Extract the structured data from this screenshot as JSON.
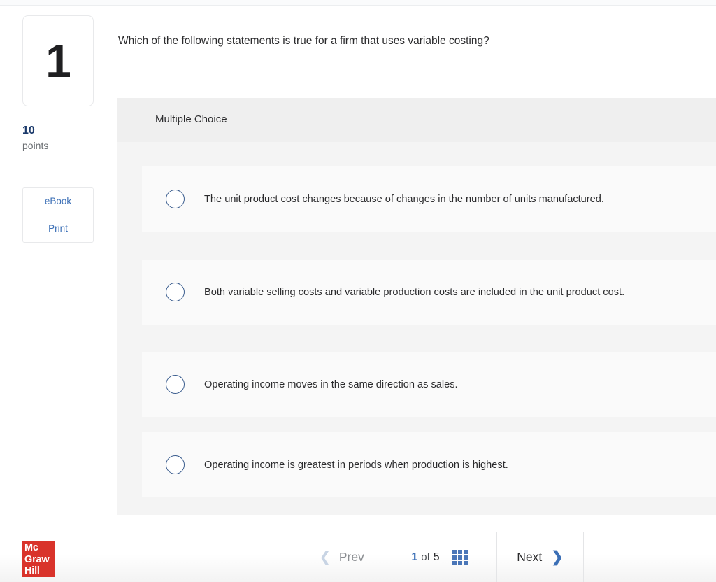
{
  "sidebar": {
    "question_number": "1",
    "points_value": "10",
    "points_label": "points",
    "ebook_label": "eBook",
    "print_label": "Print"
  },
  "question": {
    "stem": "Which of the following statements is true for a firm that uses variable costing?",
    "type_label": "Multiple Choice",
    "options": [
      {
        "text": "The unit product cost changes because of changes in the number of units manufactured."
      },
      {
        "text": "Both variable selling costs and variable production costs are included in the unit product cost."
      },
      {
        "text": "Operating income moves in the same direction as sales."
      },
      {
        "text": "Operating income is greatest in periods when production is highest."
      }
    ]
  },
  "footer": {
    "logo_line1": "Mc",
    "logo_line2": "Graw",
    "logo_line3": "Hill",
    "prev_label": "Prev",
    "next_label": "Next",
    "pager_current": "1",
    "pager_of": "of",
    "pager_total": "5"
  },
  "colors": {
    "accent_blue": "#3b6fb6",
    "points_navy": "#1b3a6b",
    "logo_red": "#d9332b",
    "panel_gray": "#f4f4f4",
    "header_gray": "#efefef",
    "option_card": "#fafafa"
  }
}
